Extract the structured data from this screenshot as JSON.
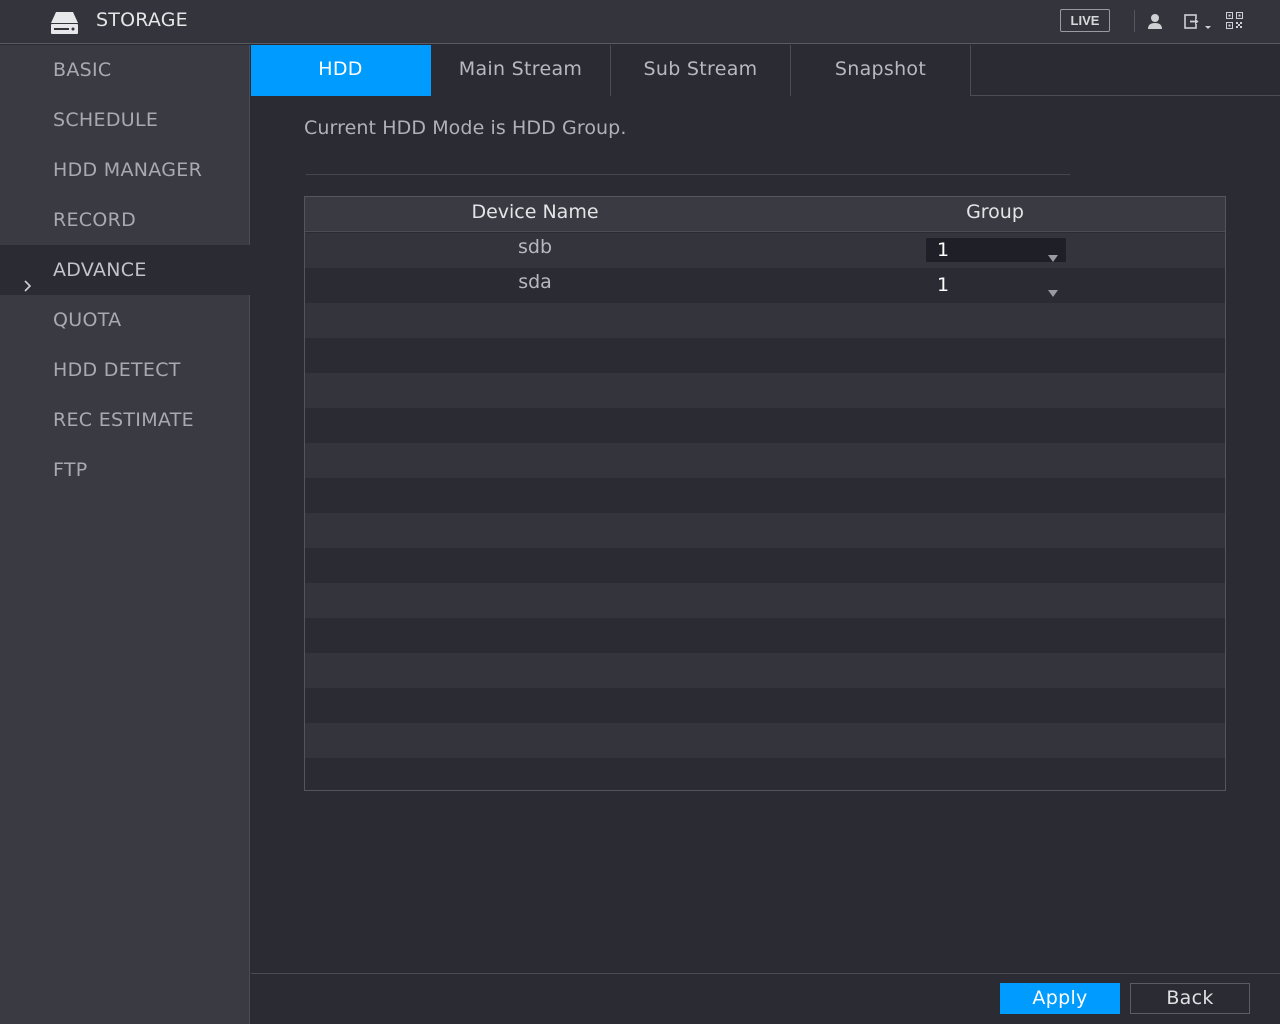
{
  "header": {
    "title": "STORAGE",
    "live_label": "LIVE"
  },
  "sidebar": {
    "items": [
      {
        "label": "BASIC"
      },
      {
        "label": "SCHEDULE"
      },
      {
        "label": "HDD MANAGER"
      },
      {
        "label": "RECORD"
      },
      {
        "label": "ADVANCE",
        "active": true
      },
      {
        "label": "QUOTA"
      },
      {
        "label": "HDD DETECT"
      },
      {
        "label": "REC ESTIMATE"
      },
      {
        "label": "FTP"
      }
    ]
  },
  "tabs": [
    {
      "label": "HDD",
      "active": true
    },
    {
      "label": "Main Stream"
    },
    {
      "label": "Sub Stream"
    },
    {
      "label": "Snapshot"
    }
  ],
  "main": {
    "mode_text": "Current HDD Mode is HDD Group.",
    "table": {
      "columns": [
        "Device Name",
        "Group"
      ],
      "rows": [
        {
          "device": "sdb",
          "group": "1"
        },
        {
          "device": "sda",
          "group": "1"
        }
      ]
    }
  },
  "buttons": {
    "apply": "Apply",
    "back": "Back"
  },
  "colors": {
    "accent": "#009bff",
    "background": "#2a2b33",
    "sidebar": "#393a42"
  }
}
